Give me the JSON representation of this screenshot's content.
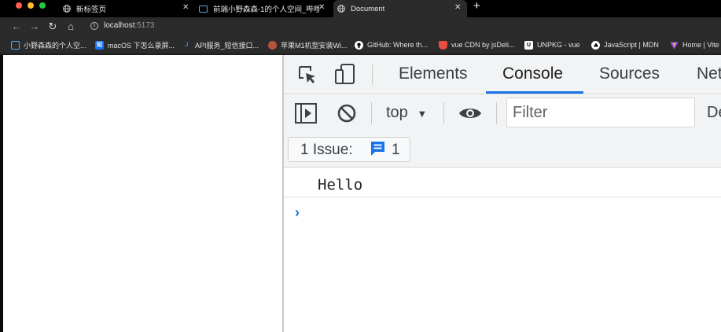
{
  "window": {
    "traffic_lights": [
      "#ff5f57",
      "#febc2e",
      "#28c840"
    ]
  },
  "tabs": [
    {
      "label": "新标签页",
      "active": false
    },
    {
      "label": "前端小野森森-1的个人空间_哔哩",
      "active": false
    },
    {
      "label": "Document",
      "active": true
    }
  ],
  "new_tab_label": "+",
  "close_glyph": "✕",
  "nav": {
    "back": "←",
    "forward": "→",
    "reload": "↻",
    "home": "⌂"
  },
  "url": {
    "host": "localhost",
    "port": ":5173"
  },
  "bookmarks": [
    {
      "label": "小野森森的个人空...",
      "icon": "bilibili-icon",
      "color": "#5aa8e8",
      "glyph": ""
    },
    {
      "label": "macOS 下怎么录屏...",
      "icon": "zhihu-icon",
      "color": "#1772f6",
      "glyph": "知"
    },
    {
      "label": "API服务_短信接口...",
      "icon": "api-icon",
      "color": "#3a8ee6",
      "glyph": "J"
    },
    {
      "label": "苹果M1机型安装Wi...",
      "icon": "blog-icon",
      "color": "#b5543b",
      "glyph": ""
    },
    {
      "label": "GitHub: Where th...",
      "icon": "github-icon",
      "color": "#ffffff",
      "glyph": ""
    },
    {
      "label": "vue CDN by jsDeli...",
      "icon": "jsdelivr-icon",
      "color": "#e84d3d",
      "glyph": ""
    },
    {
      "label": "UNPKG - vue",
      "icon": "unpkg-icon",
      "color": "#ffffff",
      "glyph": "U"
    },
    {
      "label": "JavaScript | MDN",
      "icon": "mdn-icon",
      "color": "#ffffff",
      "glyph": ""
    },
    {
      "label": "Home | Vite",
      "icon": "vite-icon",
      "color": "#a855f7",
      "glyph": ""
    }
  ],
  "devtools": {
    "tabs": [
      "Elements",
      "Console",
      "Sources",
      "Network"
    ],
    "active_tab": "Console",
    "accent": "#1a73e8",
    "context": "top",
    "context_arrow": "▼",
    "filter_placeholder": "Filter",
    "levels_label": "Default levels",
    "issues": {
      "label": "1 Issue:",
      "count": "1"
    },
    "console_messages": [
      "Hello"
    ],
    "prompt_glyph": "›"
  }
}
